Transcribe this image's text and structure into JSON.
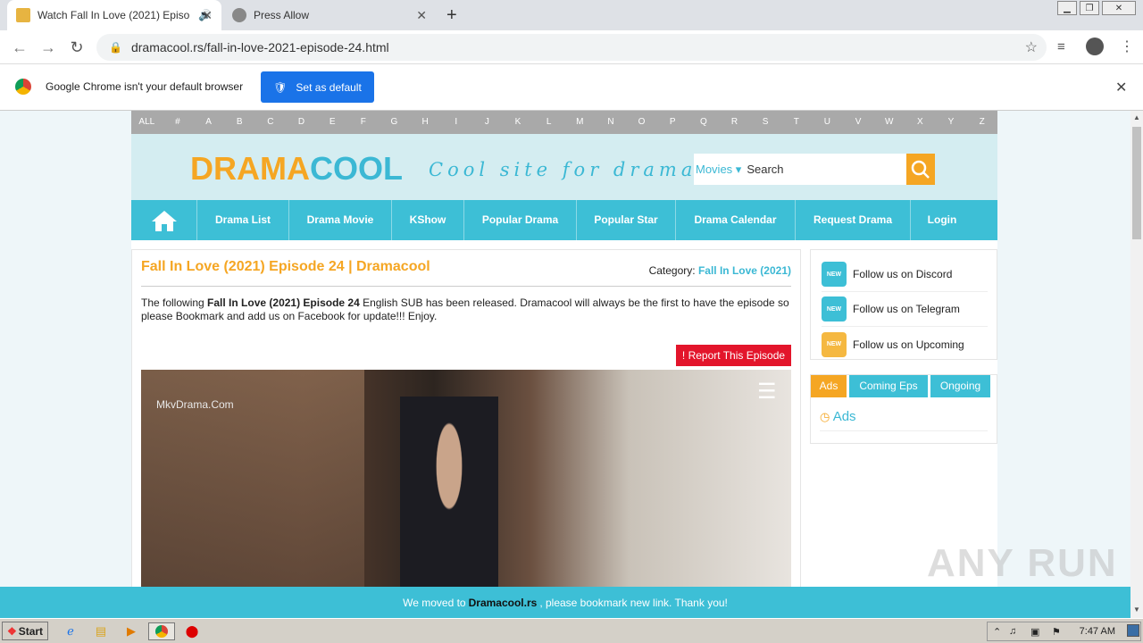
{
  "browser": {
    "tabs": [
      {
        "title": "Watch Fall In Love (2021) Episo"
      },
      {
        "title": "Press Allow"
      }
    ],
    "url": "dramacool.rs/fall-in-love-2021-episode-24.html",
    "infobar_text": "Google Chrome isn't your default browser",
    "set_default_label": "Set as default"
  },
  "site": {
    "alphabet": [
      "ALL",
      "#",
      "A",
      "B",
      "C",
      "D",
      "E",
      "F",
      "G",
      "H",
      "I",
      "J",
      "K",
      "L",
      "M",
      "N",
      "O",
      "P",
      "Q",
      "R",
      "S",
      "T",
      "U",
      "V",
      "W",
      "X",
      "Y",
      "Z"
    ],
    "logo_a": "DRAMA",
    "logo_b": "COOL",
    "tagline": "Cool site for dramas",
    "search_type": "Movies",
    "search_placeholder": "Search",
    "nav": [
      "Drama List",
      "Drama Movie",
      "KShow",
      "Popular Drama",
      "Popular Star",
      "Drama Calendar",
      "Request Drama",
      "Login"
    ],
    "page_title": "Fall In Love (2021) Episode 24 | Dramacool",
    "category_label": "Category:",
    "category_value": "Fall In Love (2021)",
    "desc_pre": "The following ",
    "desc_bold": "Fall In Love (2021) Episode 24",
    "desc_post": " English SUB has been released. Dramacool will always be the first to have the episode so please Bookmark and add us on Facebook for update!!! Enjoy.",
    "report_label": "! Report This Episode",
    "video_watermark": "MkvDrama.Com",
    "social": [
      "Follow us on Discord",
      "Follow us on Telegram",
      "Follow us on Upcoming"
    ],
    "side_tabs": [
      "Ads",
      "Coming Eps",
      "Ongoing"
    ],
    "ads_heading": "Ads",
    "banner_pre": "We moved to",
    "banner_bold": "Dramacool.rs",
    "banner_post": ", please bookmark new link. Thank you!"
  },
  "taskbar": {
    "start": "Start",
    "clock": "7:47 AM"
  },
  "watermark": "ANY RUN"
}
